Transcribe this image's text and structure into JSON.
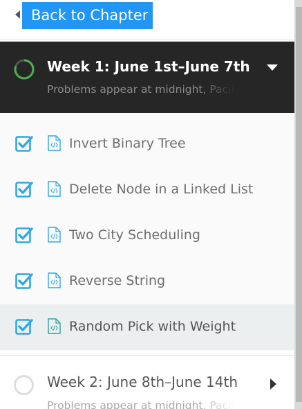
{
  "nav": {
    "back_label": "Back to Chapter"
  },
  "colors": {
    "accent": "#2196f3",
    "header_bg": "#262626",
    "progress_green": "#4caf50",
    "check_blue": "#2ea8e6"
  },
  "weeks": [
    {
      "title": "Week 1: June 1st–June 7th",
      "subtitle": "Problems appear at midnight, Pacific Time",
      "expanded": true,
      "progress_fraction": 0.8,
      "items": [
        {
          "label": "Invert Binary Tree",
          "completed": true,
          "icon": "code-file-icon"
        },
        {
          "label": "Delete Node in a Linked List",
          "completed": true,
          "icon": "code-file-icon"
        },
        {
          "label": "Two City Scheduling",
          "completed": true,
          "icon": "code-file-icon"
        },
        {
          "label": "Reverse String",
          "completed": true,
          "icon": "code-file-icon"
        },
        {
          "label": "Random Pick with Weight",
          "completed": true,
          "icon": "code-file-icon",
          "active": true
        }
      ]
    },
    {
      "title": "Week 2: June 8th–June 14th",
      "subtitle": "Problems appear at midnight, Pacific Time",
      "expanded": false,
      "progress_fraction": 0
    }
  ]
}
